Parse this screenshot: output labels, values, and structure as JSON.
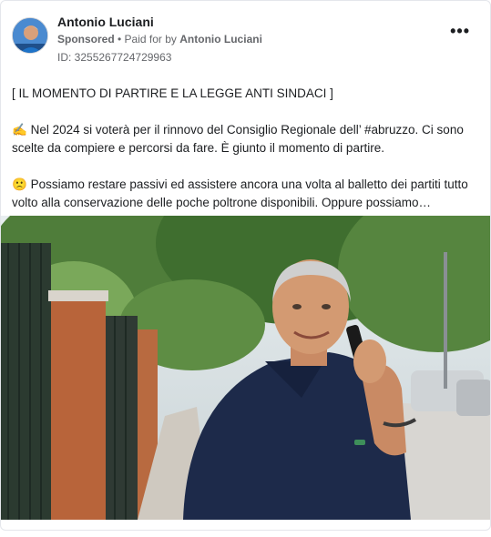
{
  "ad": {
    "advertiser_name": "Antonio Luciani",
    "sponsored_label": "Sponsored",
    "paid_for_prefix": " • Paid for by ",
    "paid_for_name": "Antonio Luciani",
    "ad_id": "ID: 3255267724729963",
    "more_icon": "•••"
  },
  "post": {
    "headline": "[ IL MOMENTO DI PARTIRE E LA LEGGE ANTI SINDACI ]",
    "para1_emoji": "✍️",
    "para1_text": " Nel 2024 si voterà per il rinnovo del Consiglio Regionale dell’ #abruzzo. Ci sono scelte da compiere e percorsi da fare. È giunto il momento di partire.",
    "para2_emoji": "🙁",
    "para2_text": " Possiamo restare passivi ed assistere ancora una volta al balletto dei partiti tutto volto alla conservazione delle poche poltrone disponibili. Oppure possiamo…"
  },
  "colors": {
    "secondary_text": "#65676b",
    "primary_text": "#1c1e21",
    "border": "#e4e6eb",
    "shirt": "#1d2a4a"
  }
}
